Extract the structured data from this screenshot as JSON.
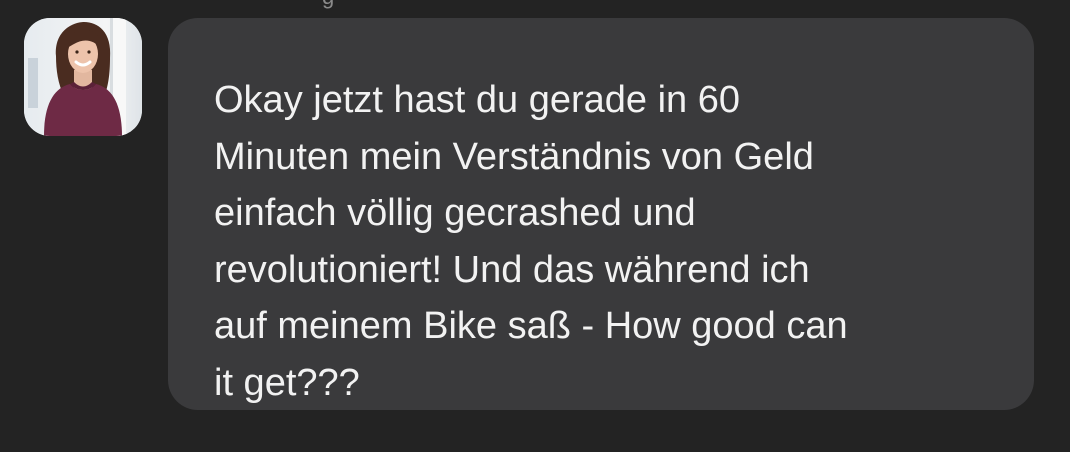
{
  "chat": {
    "top_fragment": "g",
    "message": {
      "text": "Okay jetzt hast du gerade in 60\nMinuten mein Verständnis von Geld\neinfach völlig gecrashed und\nrevolutioniert! Und das während ich\nauf meinem Bike saß - How good can\nit get???"
    }
  },
  "colors": {
    "background": "#232323",
    "bubble": "#3a3a3c",
    "text": "#f2f2f2"
  },
  "icons": {
    "avatar": "profile-photo"
  }
}
